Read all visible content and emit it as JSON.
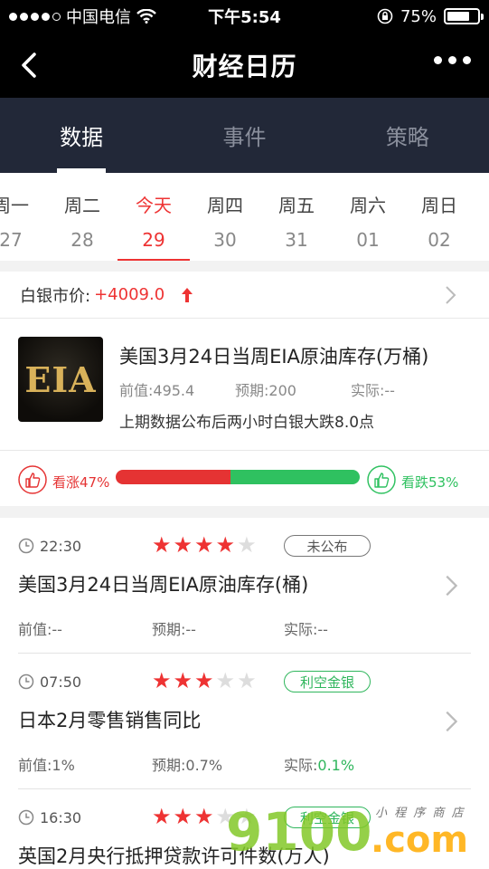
{
  "status": {
    "carrier": "中国电信",
    "time": "下午5:54",
    "battery": "75%",
    "battery_level": 0.75
  },
  "nav": {
    "title": "财经日历"
  },
  "tabs": [
    {
      "label": "数据",
      "active": true
    },
    {
      "label": "事件",
      "active": false
    },
    {
      "label": "策略",
      "active": false
    }
  ],
  "week": [
    {
      "weekday": "周一",
      "date": "27"
    },
    {
      "weekday": "周二",
      "date": "28"
    },
    {
      "weekday": "今天",
      "date": "29",
      "today": true
    },
    {
      "weekday": "周四",
      "date": "30"
    },
    {
      "weekday": "周五",
      "date": "31"
    },
    {
      "weekday": "周六",
      "date": "01"
    },
    {
      "weekday": "周日",
      "date": "02"
    }
  ],
  "silver": {
    "label": "白银市价:",
    "value": "+4009.0"
  },
  "featured": {
    "logo_text": "EIA",
    "title": "美国3月24日当周EIA原油库存(万桶)",
    "previous": "前值:495.4",
    "expected": "预期:200",
    "actual": "实际:--",
    "note": "上期数据公布后两小时白银大跌8.0点"
  },
  "vote": {
    "bull_label": "看涨47%",
    "bear_label": "看跌53%",
    "bull_fraction": 0.47,
    "bull_color": "#e53333",
    "bear_color": "#2fc160"
  },
  "items": [
    {
      "time": "22:30",
      "stars": 4,
      "badge": "未公布",
      "badge_style": "gray",
      "title": "美国3月24日当周EIA原油库存(桶)",
      "previous": "前值:--",
      "expected": "预期:--",
      "actual_label": "实际:",
      "actual_value": "--"
    },
    {
      "time": "07:50",
      "stars": 3,
      "badge": "利空金银",
      "badge_style": "green",
      "title": "日本2月零售销售同比",
      "previous": "前值:1%",
      "expected": "预期:0.7%",
      "actual_label": "实际:",
      "actual_value": "0.1%"
    },
    {
      "time": "16:30",
      "stars": 3,
      "badge": "利空金银",
      "badge_style": "green",
      "title": "英国2月央行抵押贷款许可件数(万人)"
    }
  ],
  "watermark": {
    "number": "9100",
    "domain": ".com",
    "tagline": "小 程 序 商 店"
  }
}
